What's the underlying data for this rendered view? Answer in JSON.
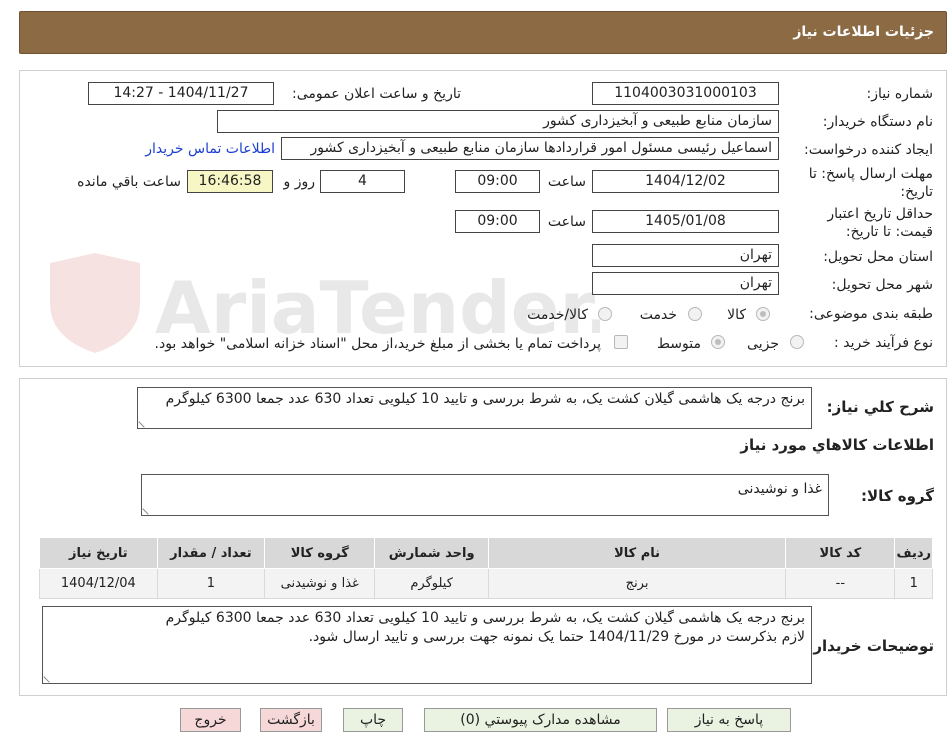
{
  "header": {
    "title": "جزئیات اطلاعات نیاز"
  },
  "fields": {
    "need_number_label": "شماره نیاز:",
    "need_number": "1104003031000103",
    "announce_label": "تاریخ و ساعت اعلان عمومی:",
    "announce_value": "1404/11/27 - 14:27",
    "buyer_org_label": "نام دستگاه خریدار:",
    "buyer_org": "سازمان منابع طبیعی و آبخیزداری کشور",
    "creator_label": "ایجاد کننده درخواست:",
    "creator": "اسماعیل رئیسی مسئول امور قراردادها سازمان منابع طبیعی و آبخیزداری کشور",
    "contact_link": "اطلاعات تماس خریدار",
    "deadline_label_1": "مهلت ارسال پاسخ: تا",
    "deadline_label_2": "تاریخ:",
    "deadline_date": "1404/12/02",
    "time_label": "ساعت",
    "deadline_time": "09:00",
    "days_value": "4",
    "days_label": "روز و",
    "remaining_time": "16:46:58",
    "remaining_label": "ساعت باقي مانده",
    "validity_label_1": "حداقل تاریخ اعتبار",
    "validity_label_2": "قیمت: تا تاریخ:",
    "validity_date": "1405/01/08",
    "validity_time": "09:00",
    "province_label": "استان محل تحویل:",
    "province": "تهران",
    "city_label": "شهر محل تحویل:",
    "city": "تهران",
    "category_label": "طبقه بندی موضوعی:",
    "category_options": [
      "کالا",
      "خدمت",
      "کالا/خدمت"
    ],
    "process_label": "نوع فرآیند خرید :",
    "process_options": [
      "جزیی",
      "متوسط"
    ],
    "payment_note": "پرداخت تمام یا بخشی از مبلغ خرید،از محل \"اسناد خزانه اسلامی\" خواهد بود."
  },
  "summary": {
    "label": "شرح کلي نياز:",
    "text": "برنج درجه یک هاشمی گیلان کشت یک، به شرط بررسی و تایید 10 کیلویی تعداد 630 عدد جمعا 6300 کیلوگرم"
  },
  "goods": {
    "section_title": "اطلاعات کالاهاي مورد نياز",
    "group_label": "گروه کالا:",
    "group_value": "غذا و نوشیدنی"
  },
  "table": {
    "headers": [
      "رديف",
      "کد کالا",
      "نام کالا",
      "واحد شمارش",
      "گروه کالا",
      "تعداد / مقدار",
      "تاريخ نياز"
    ],
    "rows": [
      [
        "1",
        "--",
        "برنج",
        "کیلوگرم",
        "غذا و نوشیدنی",
        "1",
        "1404/12/04"
      ]
    ]
  },
  "buyer_notes": {
    "label": "توضیحات خریدار:",
    "line1": "برنج درجه یک هاشمی گیلان کشت یک، به شرط بررسی و تایید 10 کیلویی تعداد 630 عدد جمعا 6300 کیلوگرم",
    "line2": "لازم بذکرست در مورخ 1404/11/29 حتما یک نمونه جهت بررسی و تایید ارسال شود."
  },
  "buttons": {
    "reply": "پاسخ به نياز",
    "attachments": "مشاهده مدارک پيوستي (0)",
    "print": "چاپ",
    "back": "بازگشت",
    "exit": "خروج"
  },
  "watermark": {
    "text": "AriaTender.neT"
  },
  "colors": {
    "header_bg": "#8b6a44",
    "link": "#1a3fd0",
    "remaining_bg": "#f7f7c6"
  }
}
